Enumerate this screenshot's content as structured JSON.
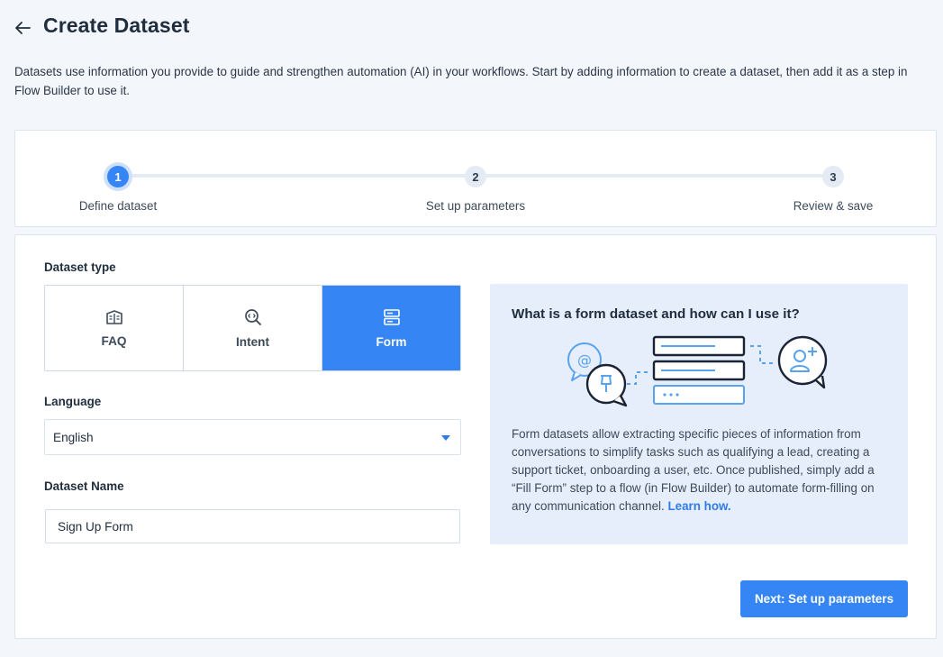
{
  "header": {
    "title": "Create Dataset",
    "back_icon": "arrow-left-icon"
  },
  "intro": "Datasets use information you provide to guide and strengthen automation (AI) in your workflows. Start by adding information to create a dataset, then add it as a step in Flow Builder to use it.",
  "stepper": {
    "steps": [
      {
        "number": "1",
        "label": "Define dataset",
        "active": true
      },
      {
        "number": "2",
        "label": "Set up parameters",
        "active": false
      },
      {
        "number": "3",
        "label": "Review & save",
        "active": false
      }
    ]
  },
  "form": {
    "dataset_type_label": "Dataset type",
    "types": [
      {
        "label": "FAQ",
        "icon": "faq-book-icon",
        "selected": false
      },
      {
        "label": "Intent",
        "icon": "intent-search-icon",
        "selected": false
      },
      {
        "label": "Form",
        "icon": "form-icon",
        "selected": true
      }
    ],
    "language_label": "Language",
    "language_value": "English",
    "name_label": "Dataset Name",
    "name_value": "Sign Up Form"
  },
  "info": {
    "title": "What is a form dataset and how can I use it?",
    "body": "Form datasets allow extracting specific pieces of information from conversations to simplify tasks such as qualifying a lead, creating a support ticket, onboarding a user, etc. Once published, simply add a “Fill Form” step to a flow (in Flow Builder) to automate form-filling on any communication channel.",
    "link": "Learn how."
  },
  "next_button": "Next: Set up parameters",
  "colors": {
    "accent": "#3585f5",
    "page_bg": "#f3f6fb",
    "panel_bg": "#e6eefb"
  }
}
